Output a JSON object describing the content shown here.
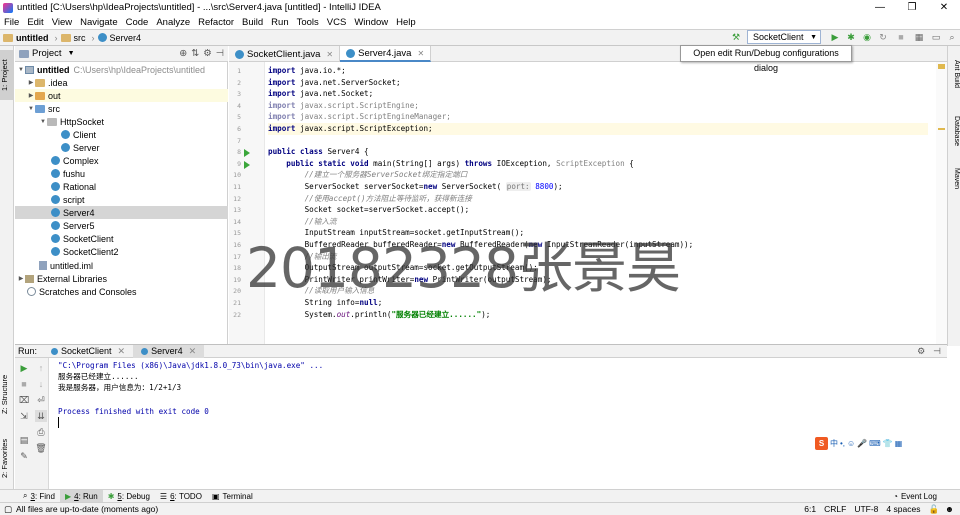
{
  "window": {
    "title": "untitled [C:\\Users\\hp\\IdeaProjects\\untitled] - ...\\src\\Server4.java [untitled] - IntelliJ IDEA",
    "controls": [
      "—",
      "❐",
      "✕"
    ]
  },
  "menu": [
    "File",
    "Edit",
    "View",
    "Navigate",
    "Code",
    "Analyze",
    "Refactor",
    "Build",
    "Run",
    "Tools",
    "VCS",
    "Window",
    "Help"
  ],
  "nav": {
    "crumbs": [
      "untitled",
      "src",
      "Server4"
    ],
    "run_config": "SocketClient",
    "tooltip": "Open edit Run/Debug configurations dialog"
  },
  "sidebars": {
    "left_top": "1: Project",
    "left_mid": "Z: Structure",
    "left_bot": "2: Favorites",
    "right": [
      "Ant Build",
      "Database",
      "Maven"
    ]
  },
  "project": {
    "header": "Project",
    "tree": [
      {
        "label": "untitled",
        "note": "C:\\Users\\hp\\IdeaProjects\\untitled",
        "depth": 0,
        "icon": "module"
      },
      {
        "label": ".idea",
        "depth": 1,
        "icon": "folder"
      },
      {
        "label": "out",
        "depth": 1,
        "icon": "folder"
      },
      {
        "label": "src",
        "depth": 1,
        "icon": "folder"
      },
      {
        "label": "HttpSocket",
        "depth": 2,
        "icon": "folder"
      },
      {
        "label": "Client",
        "depth": 3,
        "icon": "class"
      },
      {
        "label": "Server",
        "depth": 3,
        "icon": "class"
      },
      {
        "label": "Complex",
        "depth": 2,
        "icon": "class"
      },
      {
        "label": "fushu",
        "depth": 2,
        "icon": "class"
      },
      {
        "label": "Rational",
        "depth": 2,
        "icon": "class"
      },
      {
        "label": "script",
        "depth": 2,
        "icon": "class"
      },
      {
        "label": "Server4",
        "depth": 2,
        "icon": "class"
      },
      {
        "label": "Server5",
        "depth": 2,
        "icon": "class"
      },
      {
        "label": "SocketClient",
        "depth": 2,
        "icon": "class"
      },
      {
        "label": "SocketClient2",
        "depth": 2,
        "icon": "class"
      },
      {
        "label": "untitled.iml",
        "depth": 1,
        "icon": "iml"
      },
      {
        "label": "External Libraries",
        "depth": 0,
        "icon": "extlib"
      },
      {
        "label": "Scratches and Consoles",
        "depth": 0,
        "icon": "scratch"
      }
    ]
  },
  "editor": {
    "tabs": [
      "SocketClient.java",
      "Server4.java"
    ],
    "active_tab": "Server4.java",
    "line_numbers": [
      "1",
      "2",
      "3",
      "4",
      "5",
      "6",
      "7",
      "8",
      "9",
      "10",
      "11",
      "12",
      "13",
      "14",
      "15",
      "16",
      "17",
      "18",
      "19",
      "20",
      "21",
      "22"
    ],
    "watermark": "20182328张景昊"
  },
  "run": {
    "label": "Run:",
    "tabs": [
      "SocketClient",
      "Server4"
    ],
    "output": [
      "\"C:\\Program Files (x86)\\Java\\jdk1.8.0_73\\bin\\java.exe\" ...",
      "服务器已经建立......",
      "我是服务器，用户信息为：1/2+1/3",
      "",
      "Process finished with exit code 0"
    ]
  },
  "ime": {
    "brand": "S",
    "mode": "中"
  },
  "bottom_tools": [
    {
      "num": "3",
      "label": "Find"
    },
    {
      "num": "4",
      "label": "Run"
    },
    {
      "num": "5",
      "label": "Debug"
    },
    {
      "num": "6",
      "label": "TODO"
    },
    {
      "num": "",
      "label": "Terminal"
    }
  ],
  "event_log": "Event Log",
  "status": {
    "message": "All files are up-to-date (moments ago)",
    "position": "6:1",
    "line_sep": "CRLF",
    "encoding": "UTF-8",
    "indent": "4 spaces"
  }
}
